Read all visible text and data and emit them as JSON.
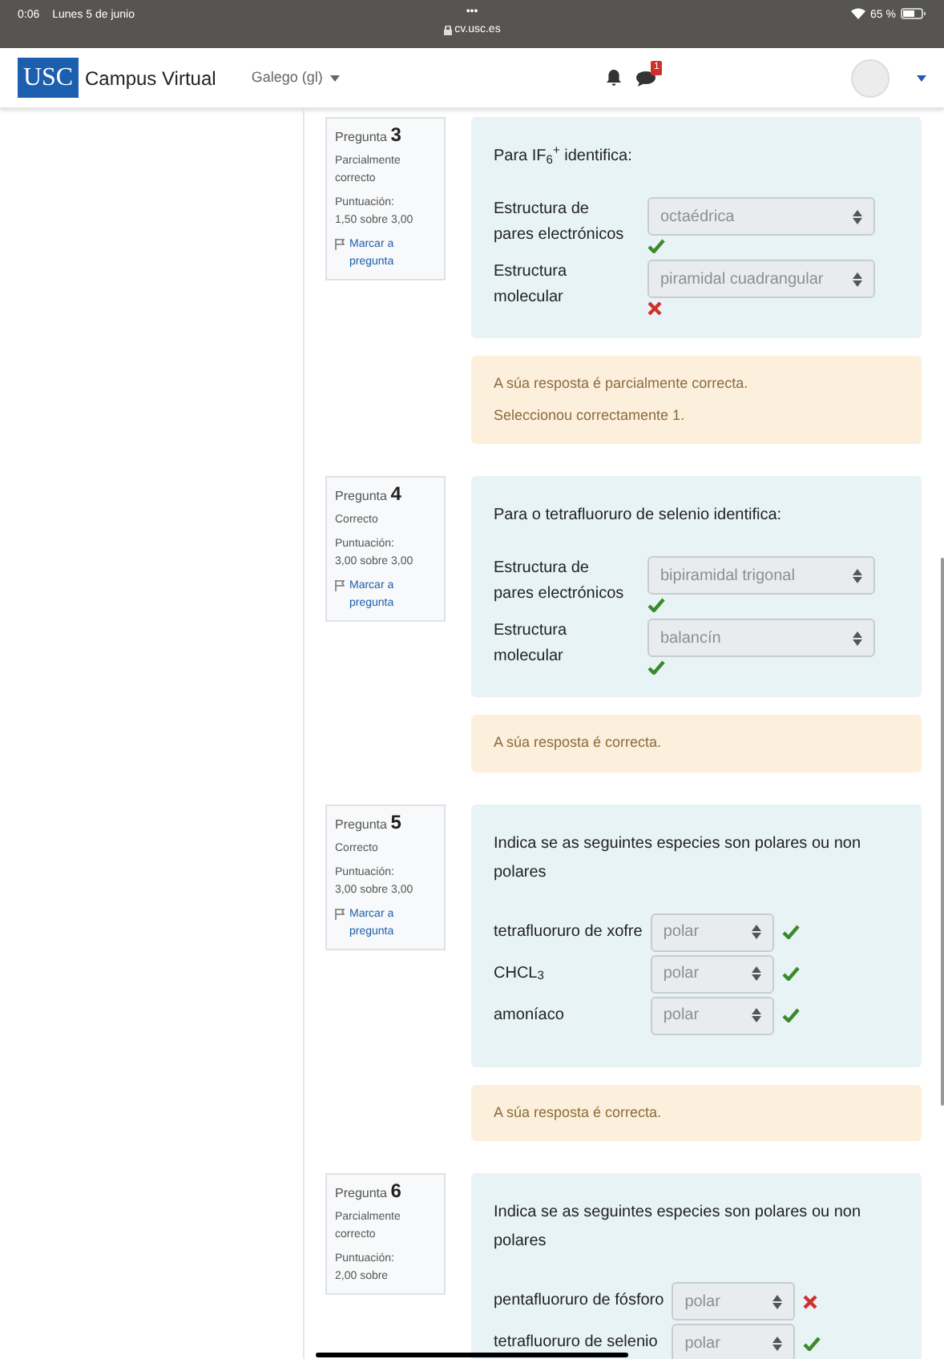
{
  "status_bar": {
    "time": "0:06",
    "date": "Lunes 5 de junio",
    "dots": "•••",
    "url": "cv.usc.es",
    "battery": "65 %"
  },
  "header": {
    "logo": "USC",
    "site_name": "Campus Virtual",
    "language": "Galego (gl)",
    "messages_badge": "1"
  },
  "questions": [
    {
      "label": "Pregunta",
      "number": "3",
      "state": "Parcialmente correcto",
      "score_label": "Puntuación:",
      "score": "1,50 sobre 3,00",
      "flag": "Marcar a pregunta",
      "prompt": "Para IF$_{6}$$^{+}$ identifica:",
      "kind": "stacked",
      "rows": [
        {
          "label": "Estructura de pares electrónicos",
          "value": "octaédrica",
          "correct": true
        },
        {
          "label": "Estructura molecular",
          "value": "piramidal cuadrangular",
          "correct": false
        }
      ],
      "feedback": [
        "A súa resposta é parcialmente correcta.",
        "Seleccionou correctamente 1."
      ]
    },
    {
      "label": "Pregunta",
      "number": "4",
      "state": "Correcto",
      "score_label": "Puntuación:",
      "score": "3,00 sobre 3,00",
      "flag": "Marcar a pregunta",
      "prompt": "Para o tetrafluoruro de selenio  identifica:",
      "kind": "stacked",
      "rows": [
        {
          "label": "Estructura de pares electrónicos",
          "value": "bipiramidal trigonal",
          "correct": true
        },
        {
          "label": "Estructura molecular",
          "value": "balancín",
          "correct": true
        }
      ],
      "feedback": [
        "A súa resposta é correcta."
      ]
    },
    {
      "label": "Pregunta",
      "number": "5",
      "state": "Correcto",
      "score_label": "Puntuación:",
      "score": "3,00 sobre 3,00",
      "flag": "Marcar a pregunta",
      "prompt": "Indica se as seguintes especies son polares ou non polares",
      "kind": "inline",
      "rows": [
        {
          "label": "tetrafluoruro de xofre",
          "value": "polar",
          "correct": true
        },
        {
          "label": "CHCL$_{3}$",
          "value": "polar",
          "correct": true
        },
        {
          "label": "amoníaco",
          "value": "polar",
          "correct": true
        }
      ],
      "feedback": [
        "A súa resposta é correcta."
      ]
    },
    {
      "label": "Pregunta",
      "number": "6",
      "state": "Parcialmente correcto",
      "score_label": "Puntuación:",
      "score": "2,00 sobre",
      "prompt": "Indica se as seguintes especies son polares ou non polares",
      "kind": "inline",
      "rows": [
        {
          "label": "pentafluoruro de fósforo",
          "value": "polar",
          "correct": false
        },
        {
          "label": "tetrafluoruro de selenio",
          "value": "polar",
          "correct": true
        }
      ]
    }
  ]
}
